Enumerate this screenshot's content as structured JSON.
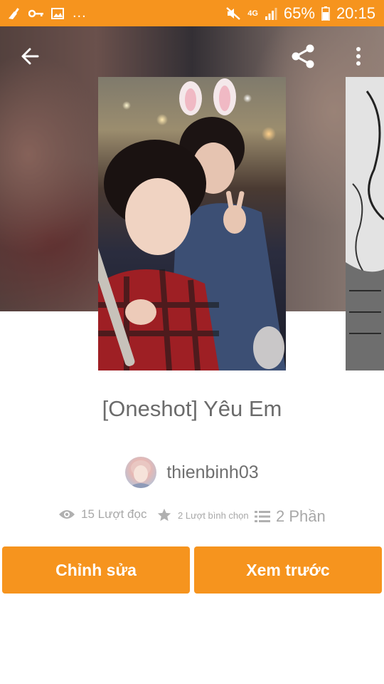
{
  "status_bar": {
    "battery_percent": "65%",
    "time": "20:15",
    "network": "4G",
    "more_notifications": "..."
  },
  "story": {
    "title": "[Oneshot] Yêu Em",
    "author": "thienbinh03"
  },
  "stats": {
    "reads": "15 Lượt đọc",
    "votes": "2 Lượt bình chọn",
    "parts": "2 Phần"
  },
  "actions": {
    "edit_label": "Chỉnh sửa",
    "preview_label": "Xem trước"
  },
  "colors": {
    "accent": "#f6941e",
    "text_muted": "#a8a8a8",
    "title_text": "#6b6b6b"
  },
  "icons": [
    "back-arrow-icon",
    "share-icon",
    "more-vert-icon",
    "eye-icon",
    "star-icon",
    "list-icon"
  ]
}
